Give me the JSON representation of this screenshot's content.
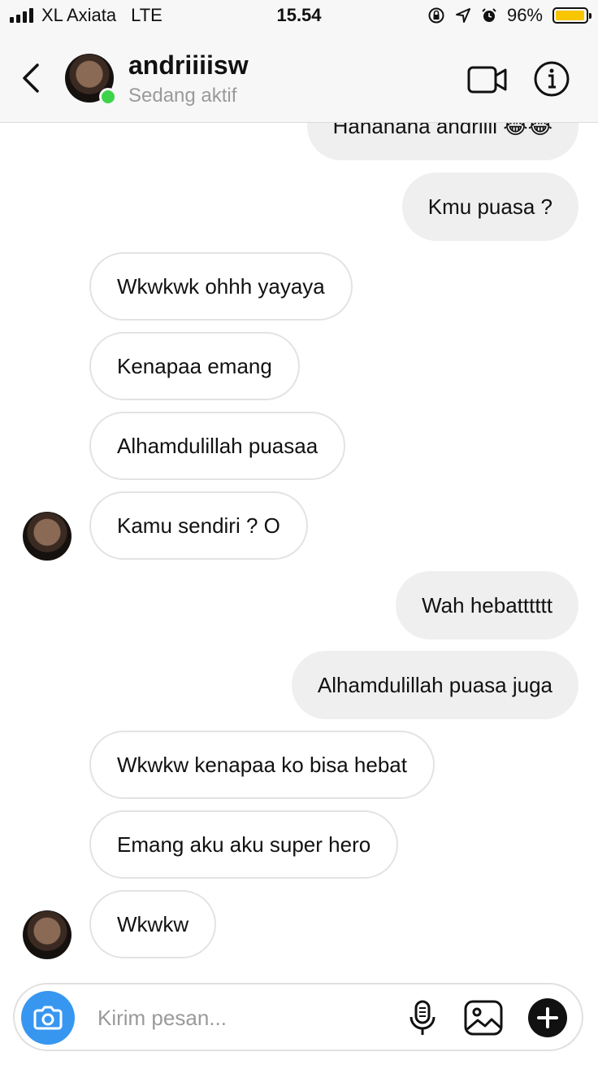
{
  "status_bar": {
    "carrier": "XL Axiata",
    "network": "LTE",
    "time": "15.54",
    "battery": "96%",
    "battery_level": 0.96,
    "icons": [
      "rotation-lock-icon",
      "location-arrow-icon",
      "alarm-icon"
    ]
  },
  "header": {
    "username": "andriiiisw",
    "status": "Sedang aktif",
    "icons": [
      "back-chevron-icon",
      "video-call-icon",
      "info-icon"
    ],
    "online_color": "#3dd34a"
  },
  "messages": [
    {
      "from": "me",
      "text": "Hahahaha andriiii 😂😂"
    },
    {
      "from": "me",
      "text": "Kmu puasa ?"
    },
    {
      "from": "them",
      "text": "Wkwkwk ohhh yayaya"
    },
    {
      "from": "them",
      "text": "Kenapaa emang"
    },
    {
      "from": "them",
      "text": "Alhamdulillah puasaa"
    },
    {
      "from": "them",
      "text": "Kamu sendiri ? O"
    },
    {
      "from": "me",
      "text": "Wah hebatttttt"
    },
    {
      "from": "me",
      "text": "Alhamdulillah puasa juga"
    },
    {
      "from": "them",
      "text": "Wkwkw kenapaa ko bisa hebat"
    },
    {
      "from": "them",
      "text": "Emang aku aku super hero"
    },
    {
      "from": "them",
      "text": "Wkwkw"
    }
  ],
  "composer": {
    "placeholder": "Kirim pesan...",
    "icons": [
      "camera-icon",
      "microphone-icon",
      "gallery-icon",
      "plus-icon"
    ],
    "accent": "#3797f0"
  }
}
